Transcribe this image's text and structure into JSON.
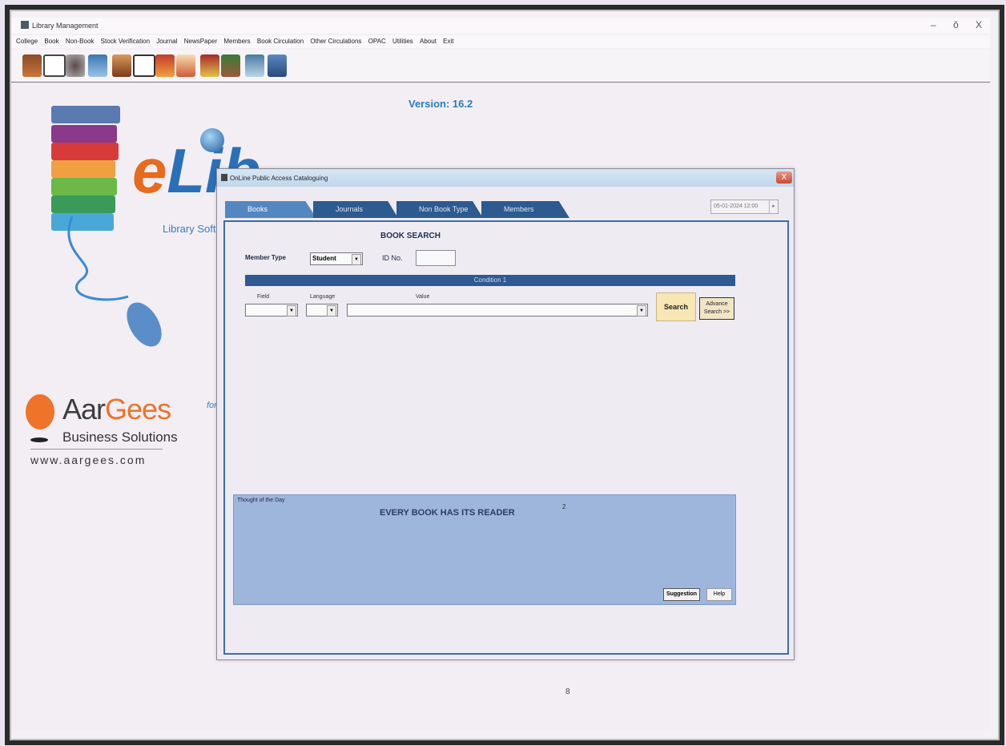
{
  "window": {
    "title": "Library Management",
    "minimize": "–",
    "maximize": "ŏ",
    "close": "X"
  },
  "menu": [
    "College",
    "Book",
    "Non-Book",
    "Stock Verification",
    "Journal",
    "NewsPaper",
    "Members",
    "Book Circulation",
    "Other Circulations",
    "OPAC",
    "Utilities",
    "About",
    "Exit"
  ],
  "toolbar_icons": [
    "books-icon",
    "calendar-icon",
    "tools-icon",
    "search-person-icon",
    "member-icon",
    "id-card-icon",
    "issue-book-icon",
    "return-book-icon",
    "journal-icon",
    "newspaper-icon",
    "report-icon",
    "help-icon"
  ],
  "splash": {
    "version": "Version: 16.2",
    "logo_text_e": "e",
    "logo_text_lib": "Lib",
    "library_software": "Library Soft",
    "company_first": "Aar",
    "company_second": "Gees",
    "company_sub": "Business Solutions",
    "company_url": "www.aargees.com",
    "for_text": "for"
  },
  "dialog": {
    "title": "OnLine Public Access Cataloguing",
    "close": "X",
    "tabs": [
      "Books",
      "Journals",
      "Non Book Type",
      "Members"
    ],
    "datetime": "05-01-2024 12:00",
    "heading": "BOOK SEARCH",
    "member_type_label": "Member Type",
    "member_type_value": "Student",
    "id_no_label": "ID No.",
    "condition_label": "Condition 1",
    "field_label": "Field",
    "language_label": "Language",
    "value_label": "Value",
    "search_button": "Search",
    "advance_search_line1": "Advance",
    "advance_search_line2": "Search >>",
    "thought_label": "Thought of the Day",
    "thought_text": "EVERY BOOK HAS ITS READER",
    "thought_number": "2",
    "suggestion_button": "Suggestion",
    "help_button": "Help"
  },
  "page_number": "8",
  "colors": {
    "tab_active": "#5486c0",
    "tab_inactive": "#2d5a8f",
    "accent_orange": "#f0732a",
    "accent_blue": "#2a70b8"
  }
}
